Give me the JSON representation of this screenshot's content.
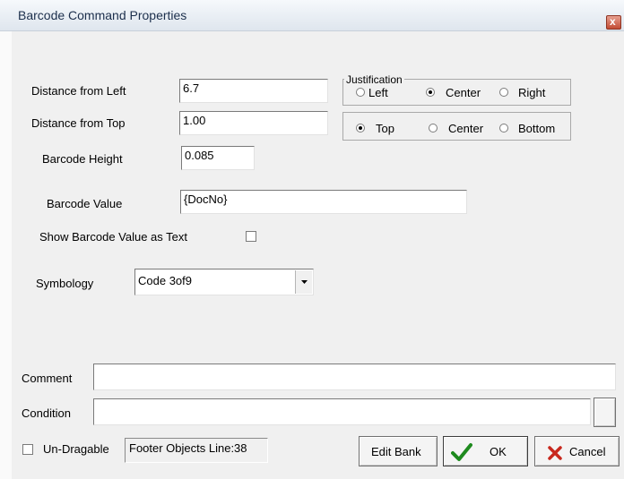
{
  "window": {
    "title": "Barcode Command Properties",
    "close_glyph": "x"
  },
  "form": {
    "distance_left_label": "Distance from Left",
    "distance_left_value": "6.7",
    "distance_top_label": "Distance from Top",
    "distance_top_value": "1.00",
    "barcode_height_label": "Barcode Height",
    "barcode_height_value": "0.085",
    "barcode_value_label": "Barcode Value",
    "barcode_value_value": "{DocNo}",
    "show_value_label": "Show Barcode Value as Text",
    "show_value_checked": false,
    "symbology_label": "Symbology",
    "symbology_value": "Code 3of9"
  },
  "justification": {
    "group_label": "Justification",
    "horizontal": [
      {
        "label": "Left",
        "selected": false
      },
      {
        "label": "Center",
        "selected": true
      },
      {
        "label": "Right",
        "selected": false
      }
    ],
    "vertical": [
      {
        "label": "Top",
        "selected": true
      },
      {
        "label": "Center",
        "selected": false
      },
      {
        "label": "Bottom",
        "selected": false
      }
    ]
  },
  "footer": {
    "comment_label": "Comment",
    "comment_value": "",
    "condition_label": "Condition",
    "condition_value": "",
    "undragable_label": "Un-Dragable",
    "undragable_checked": false,
    "status_text": "Footer Objects  Line:38",
    "edit_bank_label": "Edit Bank",
    "ok_label": "OK",
    "cancel_label": "Cancel"
  },
  "icons": {
    "ok": "checkmark-icon",
    "cancel": "x-icon",
    "dropdown": "chevron-down-icon"
  },
  "colors": {
    "ok_check": "#1e8a1e",
    "cancel_x": "#c8281e",
    "title_text": "#1c2f4c"
  }
}
